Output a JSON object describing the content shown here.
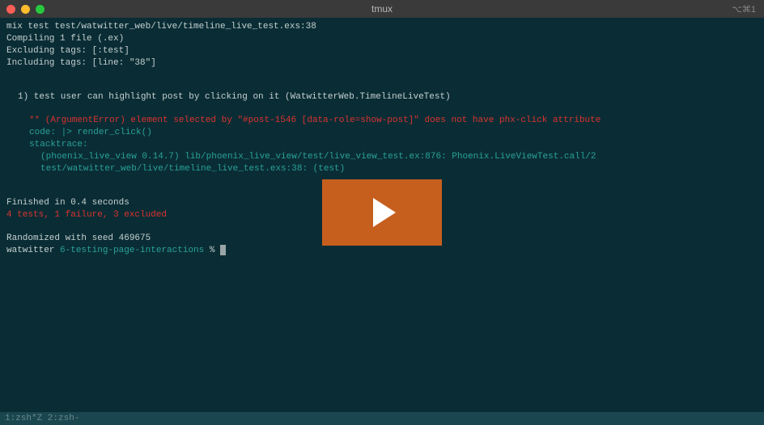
{
  "window": {
    "title": "tmux",
    "right_indicator": "⌥⌘1"
  },
  "terminal": {
    "lines": {
      "cmd": "mix test test/watwitter_web/live/timeline_live_test.exs:38",
      "compiling": "Compiling 1 file (.ex)",
      "excluding": "Excluding tags: [:test]",
      "including": "Including tags: [line: \"38\"]",
      "test_header": "1) test user can highlight post by clicking on it (WatwitterWeb.TimelineLiveTest)",
      "error": "** (ArgumentError) element selected by \"#post-1546 [data-role=show-post]\" does not have phx-click attribute",
      "code": "code: |> render_click()",
      "stacktrace": "stacktrace:",
      "trace1": "(phoenix_live_view 0.14.7) lib/phoenix_live_view/test/live_view_test.ex:876: Phoenix.LiveViewTest.call/2",
      "trace2": "test/watwitter_web/live/timeline_live_test.exs:38: (test)",
      "finished": "Finished in 0.4 seconds",
      "summary": "4 tests, 1 failure, 3 excluded",
      "randomized": "Randomized with seed 469675"
    },
    "prompt": {
      "host": "watwitter",
      "branch": "6-testing-page-interactions",
      "symbol": "%"
    }
  },
  "statusbar": {
    "text": "1:zsh*Z 2:zsh-"
  }
}
